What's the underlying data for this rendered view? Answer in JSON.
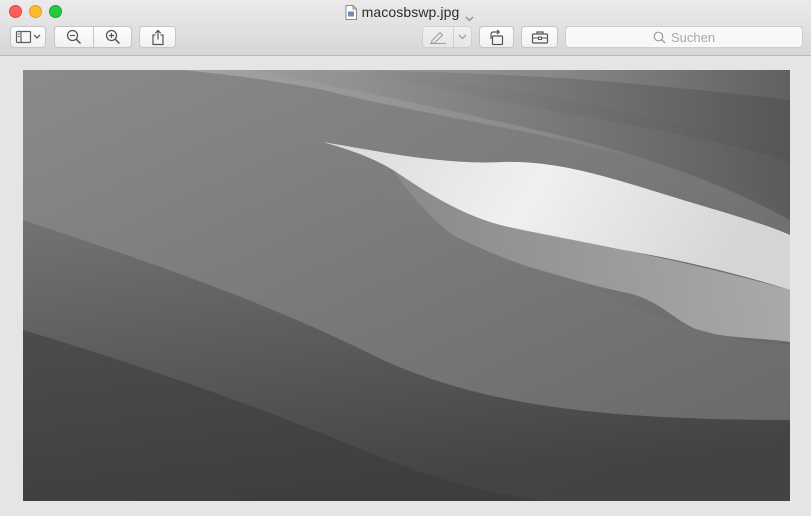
{
  "window": {
    "title": "macosbswp.jpg"
  },
  "toolbar": {
    "search_placeholder": "Suchen"
  },
  "icons": {
    "close": "close-button",
    "minimize": "minimize-button",
    "zoom": "zoom-button",
    "document": "document-icon",
    "title_menu": "chevron-down-icon",
    "sidebar": "sidebar-icon",
    "zoom_out": "zoom-out-icon",
    "zoom_in": "zoom-in-icon",
    "share": "share-icon",
    "markup": "pen-icon",
    "rotate": "rotate-icon",
    "toolbox": "toolbox-icon",
    "search": "search-icon"
  },
  "colors": {
    "close": "#fd5f58",
    "minimize": "#fdbc2e",
    "zoom": "#28c93f"
  }
}
